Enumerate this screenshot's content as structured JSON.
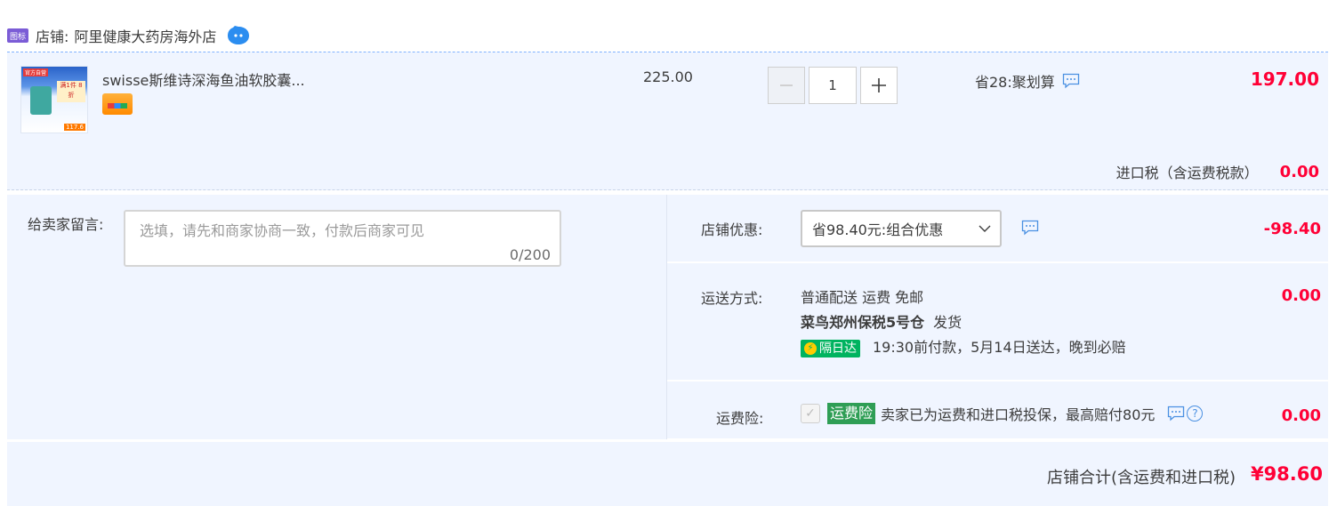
{
  "shop": {
    "badge": "图标",
    "label": "店铺:",
    "name": "阿里健康大药房海外店"
  },
  "item": {
    "thumb_tag": "官方自营",
    "thumb_promo": "满1件 8折",
    "thumb_price": "117.6",
    "title": "swisse斯维诗深海鱼油软胶囊...",
    "unit_price": "225.00",
    "quantity": "1",
    "discount_text": "省28:聚划算",
    "total": "197.00",
    "tax_label": "进口税（含运费税款）",
    "tax_value": "0.00"
  },
  "message": {
    "label": "给卖家留言:",
    "placeholder": "选填，请先和商家协商一致，付款后商家可见",
    "counter": "0/200"
  },
  "shop_discount": {
    "label": "店铺优惠:",
    "selected": "省98.40元:组合优惠",
    "value": "-98.40"
  },
  "shipping": {
    "label": "运送方式:",
    "method": "普通配送 运费 免邮",
    "warehouse": "菜鸟郑州保税5号仓",
    "dispatch": "发货",
    "badge": "隔日达",
    "delivery_note": "19:30前付款，5月14日送达，晚到必赔",
    "value": "0.00"
  },
  "insurance": {
    "label": "运费险:",
    "tag": "运费险",
    "text": "卖家已为运费和进口税投保，最高赔付80元",
    "value": "0.00"
  },
  "summary": {
    "label": "店铺合计(含运费和进口税)",
    "value": "¥98.60"
  },
  "colors": {
    "price_red": "#ff0036",
    "panel_bg": "#f0f5ff",
    "next_day_green": "#00b35f",
    "insurance_green": "#2f9e55"
  },
  "icons": [
    "tmall-icon",
    "chat-bubble-icon",
    "message-icon",
    "help-icon",
    "chevron-down-icon",
    "lightning-icon",
    "card-icon",
    "check-icon"
  ]
}
